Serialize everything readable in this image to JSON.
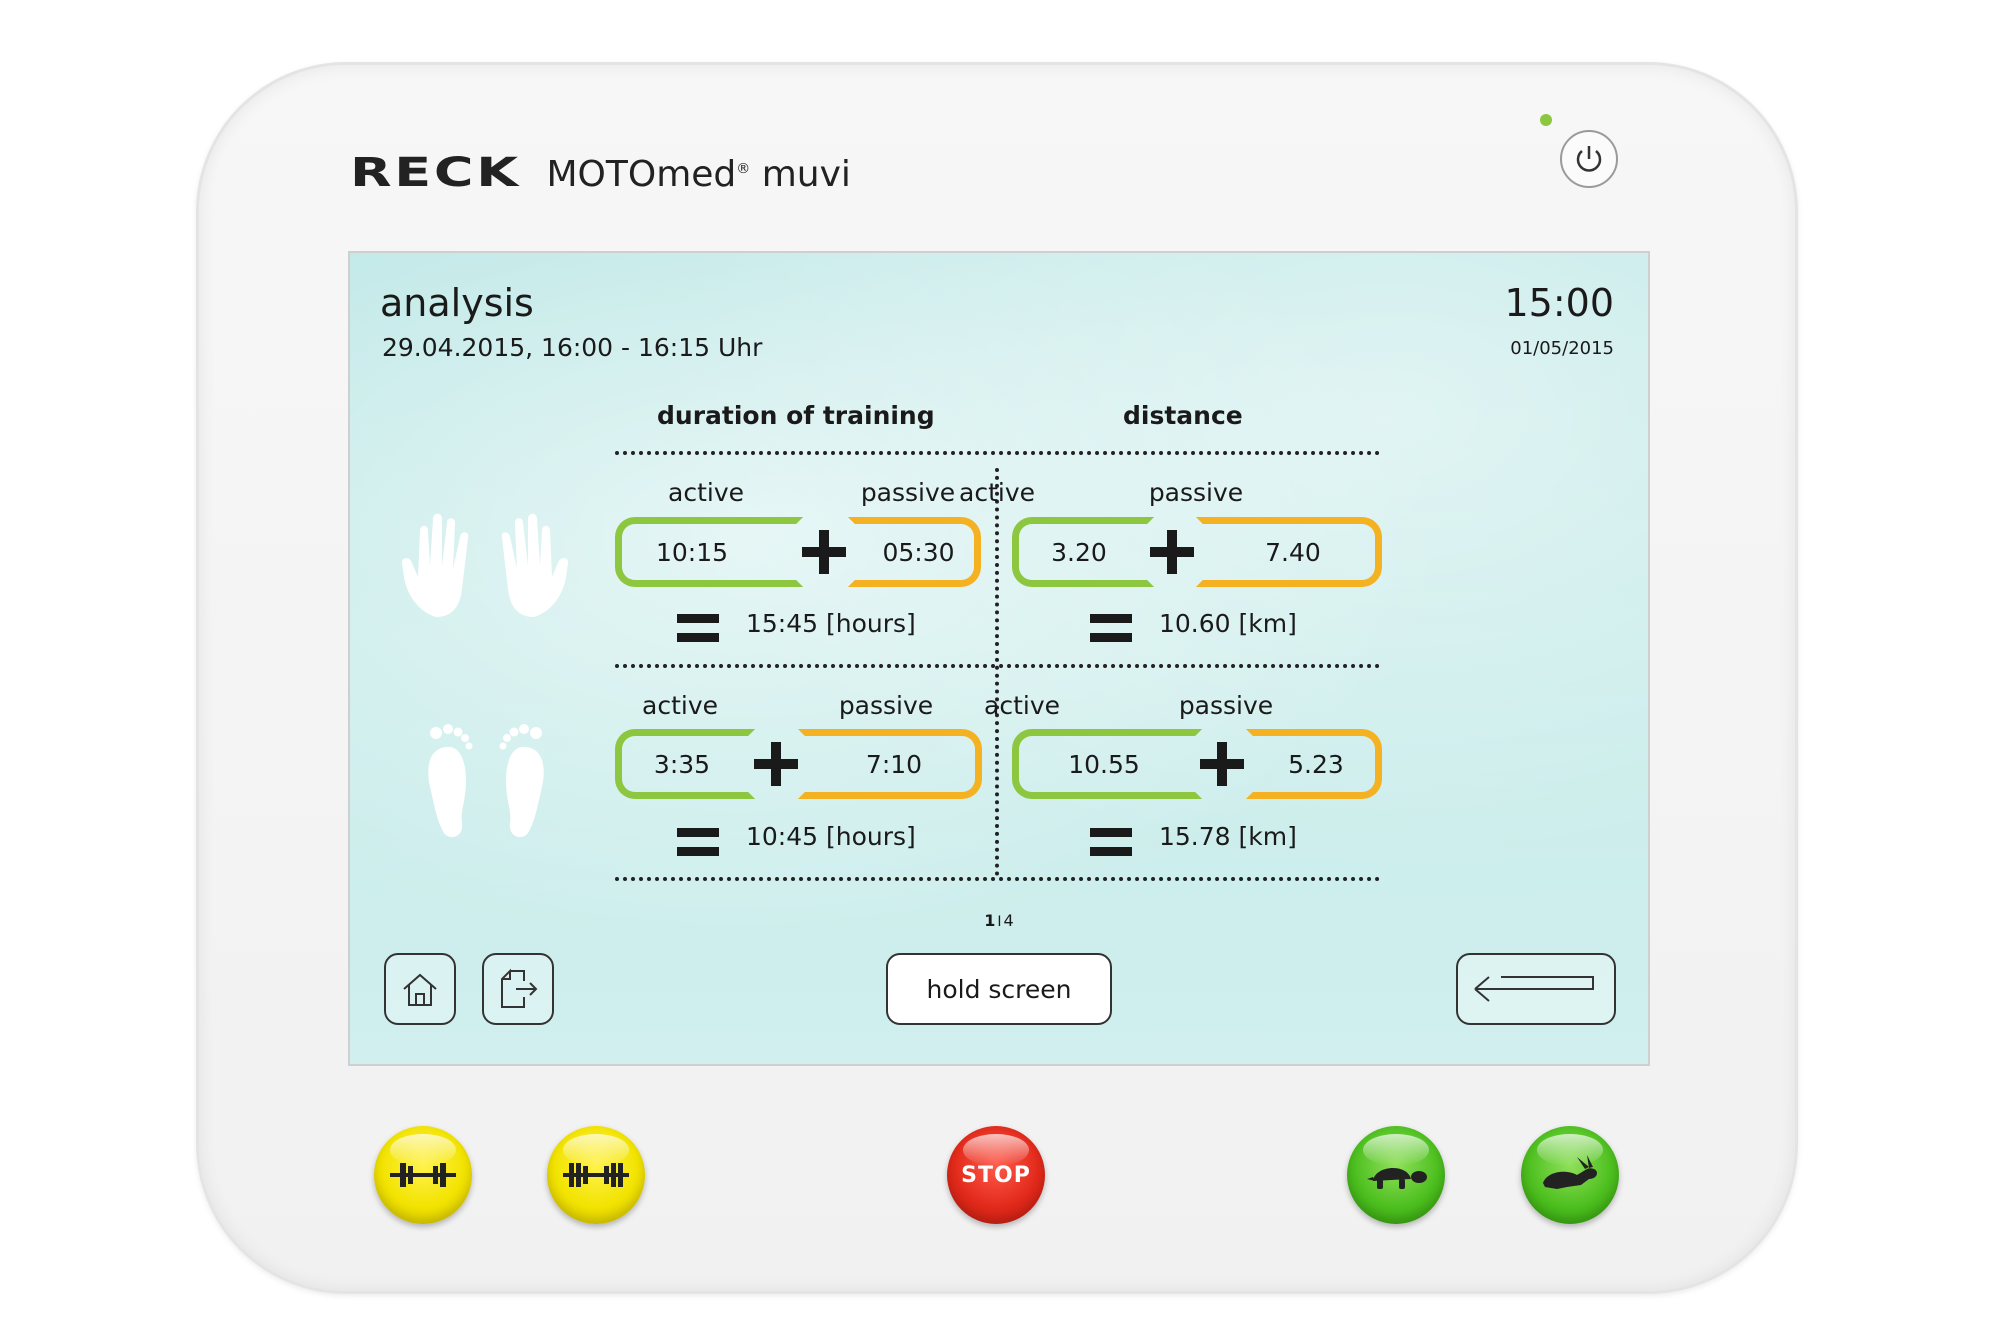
{
  "brand": {
    "logo": "RECK",
    "product": "MOTOmed",
    "reg": "®",
    "model": "muvi"
  },
  "screen": {
    "title": "analysis",
    "subtitle": "29.04.2015, 16:00 - 16:15 Uhr",
    "time": "15:00",
    "date": "01/05/2015",
    "columns": {
      "duration": "duration of training",
      "distance": "distance"
    },
    "rows": [
      {
        "limb": "hands",
        "duration": {
          "active_label": "active",
          "passive_label": "passive",
          "active": "10:15",
          "passive": "05:30",
          "total": "15:45 [hours]"
        },
        "distance": {
          "active_label": "active",
          "passive_label": "passive",
          "active": "3.20",
          "passive": "7.40",
          "total": "10.60 [km]"
        }
      },
      {
        "limb": "feet",
        "duration": {
          "active_label": "active",
          "passive_label": "passive",
          "active": "3:35",
          "passive": "7:10",
          "total": "10:45 [hours]"
        },
        "distance": {
          "active_label": "active",
          "passive_label": "passive",
          "active": "10.55",
          "passive": "5.23",
          "total": "15.78 [km]"
        }
      }
    ],
    "pager": {
      "current": "1",
      "separator": "I",
      "total": "4"
    },
    "hold_label": "hold screen"
  },
  "hardware": {
    "stop_label": "STOP"
  },
  "colors": {
    "active": "#8dc63f",
    "passive": "#f4b223",
    "screen_bg": "#c8ecea"
  }
}
